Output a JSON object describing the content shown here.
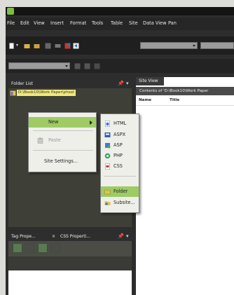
{
  "menubar": [
    "File",
    "Edit",
    "View",
    "Insert",
    "Format",
    "Tools",
    "Table",
    "Site",
    "Data View",
    "Pan"
  ],
  "folder_panel": {
    "tab_label": "Folder List",
    "pin_icon": "pin-icon",
    "path": "D:\\Book10\\Work Paper\\phsol"
  },
  "site_view": {
    "tab_label": "Site View",
    "contents_label": "Contents of 'D:\\Book10\\Work Paper",
    "columns": [
      "Name",
      "Title"
    ]
  },
  "context_menu": {
    "new_label": "New",
    "paste_label": "Paste",
    "site_settings_label": "Site Settings..."
  },
  "new_submenu": {
    "items": [
      "HTML",
      "ASPX",
      "ASP",
      "PHP",
      "CSS",
      "Folder",
      "Subsite..."
    ]
  },
  "tag_panel": {
    "tab1_label": "Tag Prope...",
    "tab2_label": "CSS Properti..."
  },
  "colors": {
    "highlight": "#9ecb63",
    "path_highlight": "#f1e979",
    "dark_chrome": "#2d2d2d"
  }
}
